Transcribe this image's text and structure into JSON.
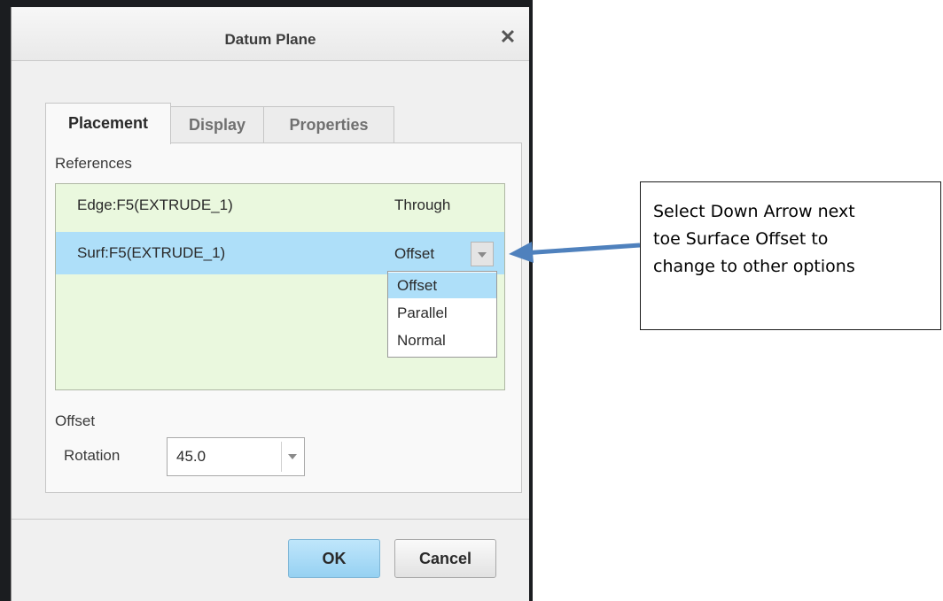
{
  "dialog": {
    "title": "Datum Plane",
    "close_glyph": "✕"
  },
  "tabs": [
    {
      "label": "Placement",
      "active": true
    },
    {
      "label": "Display",
      "active": false
    },
    {
      "label": "Properties",
      "active": false
    }
  ],
  "placement": {
    "references_label": "References",
    "references": [
      {
        "name": "Edge:F5(EXTRUDE_1)",
        "constraint": "Through",
        "selected": false
      },
      {
        "name": "Surf:F5(EXTRUDE_1)",
        "constraint": "Offset",
        "selected": true
      }
    ],
    "constraint_options": [
      "Offset",
      "Parallel",
      "Normal"
    ],
    "highlighted_option": "Offset",
    "offset_label": "Offset",
    "rotation_label": "Rotation",
    "rotation_value": "45.0"
  },
  "buttons": {
    "ok": "OK",
    "cancel": "Cancel"
  },
  "callout": {
    "lines": [
      "Select Down Arrow next",
      "toe Surface Offset to",
      "change to other options"
    ]
  },
  "colors": {
    "selection": "#aedff9",
    "references_bg": "#eaf8de",
    "ok_button": "#96d1f2",
    "annotation_arrow": "#4f81bd"
  },
  "icons": {
    "close": "close-icon",
    "dropdown": "chevron-down-icon",
    "annotation": "arrow-left-icon"
  }
}
